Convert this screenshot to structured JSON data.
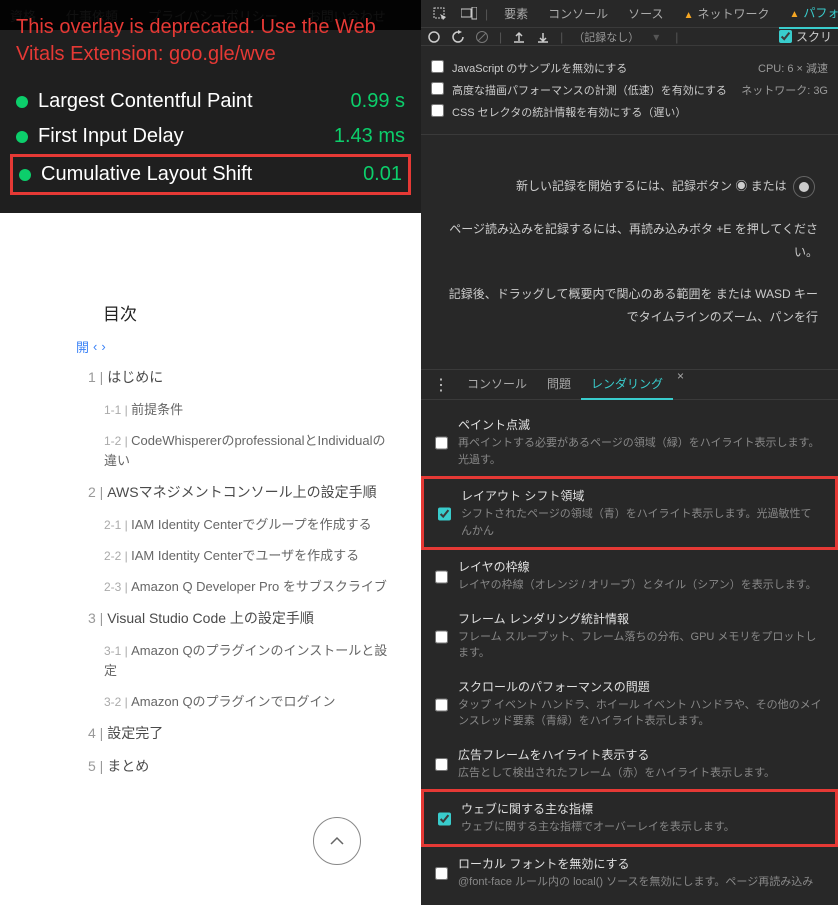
{
  "bg_nav": {
    "items": [
      "資格",
      "仕事依頼",
      "プライバシーポリシー",
      "お問い合わせ"
    ]
  },
  "vitals": {
    "deprecation": "This overlay is deprecated. Use the Web Vitals Extension: goo.gle/wve",
    "metrics": [
      {
        "name": "Largest Contentful Paint",
        "value": "0.99 s",
        "status": "good",
        "highlighted": false
      },
      {
        "name": "First Input Delay",
        "value": "1.43 ms",
        "status": "good",
        "highlighted": false
      },
      {
        "name": "Cumulative Layout Shift",
        "value": "0.01",
        "status": "good",
        "highlighted": true
      }
    ]
  },
  "toc": {
    "title": "目次",
    "expand_label": "開",
    "items": [
      {
        "idx": "1",
        "label": "はじめに",
        "subs": [
          {
            "idx": "1-1",
            "label": "前提条件"
          },
          {
            "idx": "1-2",
            "label": "CodeWhispererのprofessionalとIndividualの違い"
          }
        ]
      },
      {
        "idx": "2",
        "label": "AWSマネジメントコンソール上の設定手順",
        "subs": [
          {
            "idx": "2-1",
            "label": "IAM Identity Centerでグループを作成する"
          },
          {
            "idx": "2-2",
            "label": "IAM Identity Centerでユーザを作成する"
          },
          {
            "idx": "2-3",
            "label": "Amazon Q Developer Pro をサブスクライブ"
          }
        ]
      },
      {
        "idx": "3",
        "label": "Visual Studio Code 上の設定手順",
        "subs": [
          {
            "idx": "3-1",
            "label": "Amazon Qのプラグインのインストールと設定"
          },
          {
            "idx": "3-2",
            "label": "Amazon Qのプラグインでログイン"
          }
        ]
      },
      {
        "idx": "4",
        "label": "設定完了",
        "subs": []
      },
      {
        "idx": "5",
        "label": "まとめ",
        "subs": []
      }
    ]
  },
  "devtools": {
    "main_tabs": [
      "要素",
      "コンソール",
      "ソース",
      "ネットワーク",
      "パフォ"
    ],
    "main_warn_tabs": [
      3,
      4
    ],
    "active_main_tab": 4,
    "perf_bar": {
      "record_select": "（記録なし）",
      "screenshot_label": "スクリ"
    },
    "options": [
      {
        "label": "JavaScript のサンプルを無効にする",
        "checked": false,
        "right": "CPU:  6 × 減速"
      },
      {
        "label": "高度な描画パフォーマンスの計測（低速）を有効にする",
        "checked": false,
        "right": "ネットワーク:  3G"
      },
      {
        "label": "CSS セレクタの統計情報を有効にする（遅い）",
        "checked": false,
        "right": ""
      }
    ],
    "hints": [
      "新しい記録を開始するには、記録ボタン ◉ または",
      "ページ読み込みを記録するには、再読み込みボタ +E を押してください。",
      "記録後、ドラッグして概要内で関心のある範囲を または WASD キーでタイムラインのズーム、パンを行"
    ],
    "drawer_tabs": [
      "コンソール",
      "問題",
      "レンダリング"
    ],
    "active_drawer_tab": 2,
    "rendering": [
      {
        "title": "ペイント点滅",
        "desc": "再ペイントする必要があるページの領域（緑）をハイライト表示します。光過す。",
        "checked": false,
        "highlighted": false
      },
      {
        "title": "レイアウト シフト領域",
        "desc": "シフトされたページの領域（青）をハイライト表示します。光過敏性てんかん",
        "checked": true,
        "highlighted": true
      },
      {
        "title": "レイヤの枠線",
        "desc": "レイヤの枠線（オレンジ / オリーブ）とタイル（シアン）を表示します。",
        "checked": false,
        "highlighted": false
      },
      {
        "title": "フレーム レンダリング統計情報",
        "desc": "フレーム スループット、フレーム落ちの分布、GPU メモリをプロットします。",
        "checked": false,
        "highlighted": false
      },
      {
        "title": "スクロールのパフォーマンスの問題",
        "desc": "タップ イベント ハンドラ、ホイール イベント ハンドラや、その他のメインスレッド要素（青緑）をハイライト表示します。",
        "checked": false,
        "highlighted": false
      },
      {
        "title": "広告フレームをハイライト表示する",
        "desc": "広告として検出されたフレーム（赤）をハイライト表示します。",
        "checked": false,
        "highlighted": false
      },
      {
        "title": "ウェブに関する主な指標",
        "desc": "ウェブに関する主な指標でオーバーレイを表示します。",
        "checked": true,
        "highlighted": true
      },
      {
        "title": "ローカル フォントを無効にする",
        "desc": "@font-face ルール内の local() ソースを無効にします。ページ再読み込み",
        "checked": false,
        "highlighted": false
      }
    ]
  }
}
